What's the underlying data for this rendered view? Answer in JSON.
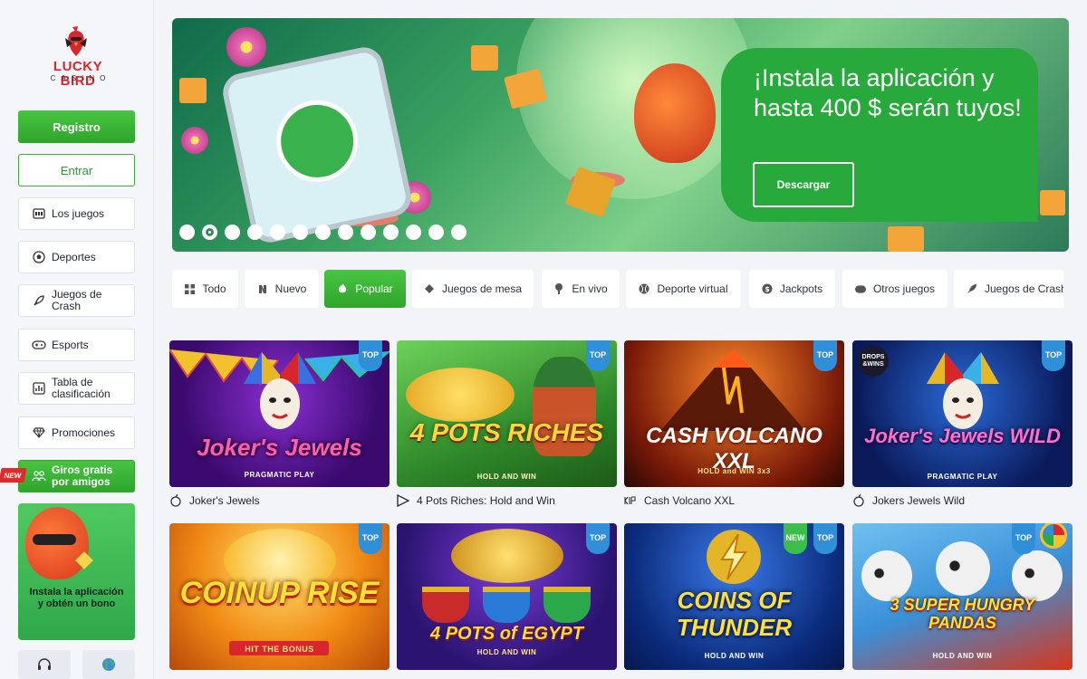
{
  "brand": {
    "name": "LUCKY BIRD",
    "sub": "CASINO",
    "color": "#d8262c"
  },
  "auth": {
    "register_label": "Registro",
    "login_label": "Entrar"
  },
  "sidebar": {
    "items": [
      {
        "label": "Los juegos",
        "icon": "slot-machine-icon"
      },
      {
        "label": "Deportes",
        "icon": "soccer-ball-icon"
      },
      {
        "label": "Juegos de Crash",
        "icon": "rocket-icon"
      },
      {
        "label": "Esports",
        "icon": "gamepad-icon"
      },
      {
        "label": "Tabla de clasificación",
        "icon": "leaderboard-icon"
      },
      {
        "label": "Promociones",
        "icon": "diamond-icon"
      }
    ],
    "referral": {
      "label": "Giros gratis por amigos",
      "badge": "NEW",
      "icon": "people-icon"
    },
    "promo": {
      "text": "Instala la aplicación y obtén un bono"
    },
    "footer": [
      {
        "icon": "headset-icon"
      },
      {
        "icon": "globe-icon"
      }
    ]
  },
  "banner": {
    "title": "¡Instala la aplicación y hasta 400 $ serán tuyos!",
    "button_label": "Descargar",
    "slides_total": 13,
    "active_slide": 2
  },
  "tabs": [
    {
      "label": "Todo",
      "icon": "grid-icon"
    },
    {
      "label": "Nuevo",
      "icon": "new-icon"
    },
    {
      "label": "Popular",
      "icon": "flame-icon",
      "active": true
    },
    {
      "label": "Juegos de mesa",
      "icon": "diamond-small-icon"
    },
    {
      "label": "En vivo",
      "icon": "live-icon"
    },
    {
      "label": "Deporte virtual",
      "icon": "ball-icon"
    },
    {
      "label": "Jackpots",
      "icon": "coin-icon"
    },
    {
      "label": "Otros juegos",
      "icon": "gamepad-small-icon"
    },
    {
      "label": "Juegos de Crash",
      "icon": "rocket-small-icon"
    }
  ],
  "games": [
    {
      "name": "Joker's Jewels",
      "art_title": "Joker's Jewels",
      "art_sub": "PRAGMATIC PLAY",
      "badges": [
        "TOP"
      ],
      "provider_icon": "pragmatic-icon"
    },
    {
      "name": "4 Pots Riches: Hold and Win",
      "art_title": "4 POTS RICHES",
      "art_sub": "HOLD AND WIN",
      "badges": [
        "TOP"
      ],
      "provider_icon": "play-triangle-icon"
    },
    {
      "name": "Cash Volcano XXL",
      "art_title": "CASH VOLCANO XXL",
      "art_sub": "HOLD and WIN 3x3",
      "badges": [
        "TOP"
      ],
      "provider_icon": "provider-glyph-icon"
    },
    {
      "name": "Jokers Jewels Wild",
      "art_title": "Joker's Jewels WILD",
      "art_sub": "PRAGMATIC PLAY",
      "badges": [
        "TOP"
      ],
      "provider_icon": "pragmatic-icon"
    },
    {
      "name": "",
      "art_title": "COINUP RISE",
      "art_sub": "HIT THE BONUS",
      "badges": [
        "TOP"
      ]
    },
    {
      "name": "",
      "art_title": "4 POTS of EGYPT",
      "art_sub": "HOLD AND WIN",
      "badges": [
        "TOP"
      ]
    },
    {
      "name": "",
      "art_title": "COINS OF THUNDER",
      "art_sub": "HOLD AND WIN",
      "badges": [
        "NEW",
        "TOP"
      ]
    },
    {
      "name": "",
      "art_title": "3 SUPER HUNGRY PANDAS",
      "art_sub": "HOLD AND WIN",
      "badges": [
        "TOP"
      ]
    }
  ],
  "colors": {
    "accent": "#2fa52b",
    "badge_top": "#2f8fd8",
    "badge_new": "#3bbf4a"
  }
}
